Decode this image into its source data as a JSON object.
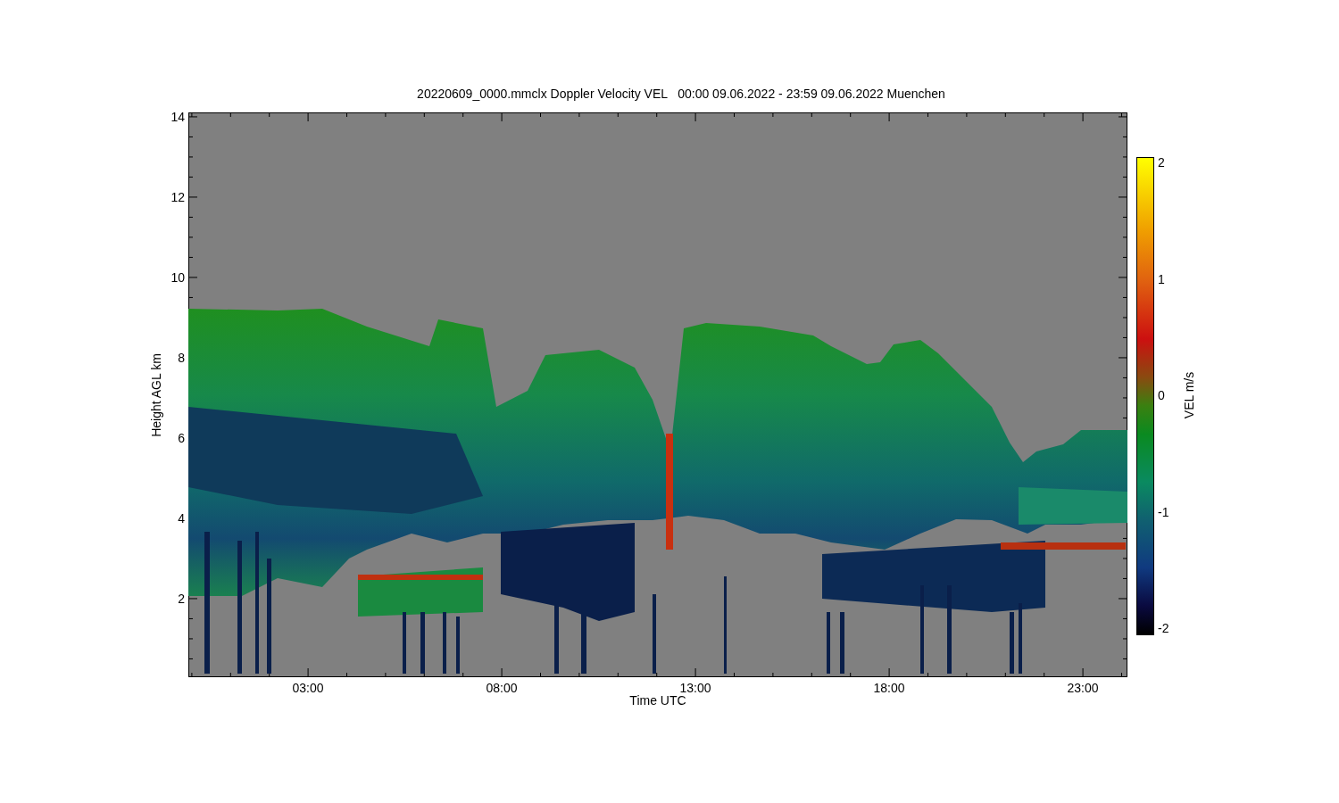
{
  "title": "20220609_0000.mmclx Doppler Velocity VEL   00:00 09.06.2022 - 23:59 09.06.2022 Muenchen",
  "y_axis": {
    "label": "Height AGL km",
    "ticks": [
      "14",
      "12",
      "10",
      "8",
      "6",
      "4",
      "2"
    ]
  },
  "x_axis": {
    "label": "Time UTC",
    "ticks": [
      "03:00",
      "08:00",
      "13:00",
      "18:00",
      "23:00"
    ]
  },
  "colorbar": {
    "label": "VEL m/s",
    "ticks": [
      "2",
      "1",
      "0",
      "-1",
      "-2"
    ]
  }
}
